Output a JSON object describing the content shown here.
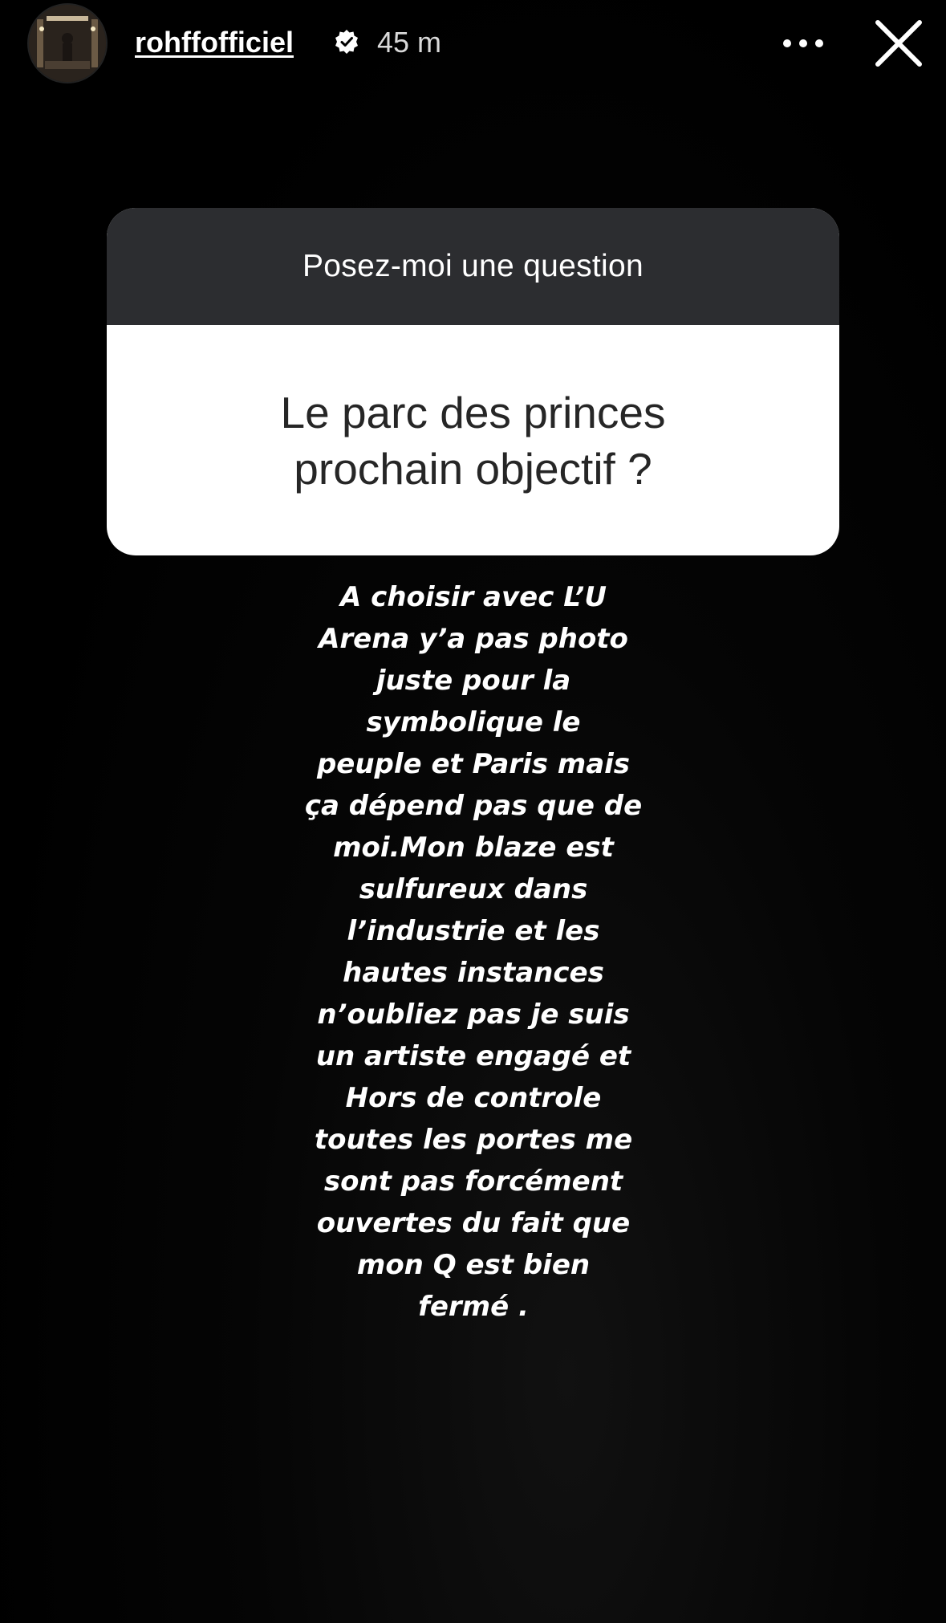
{
  "header": {
    "username": "rohffofficiel",
    "timestamp": "45 m",
    "avatar_icon": "profile-photo",
    "verified_icon": "verified-badge-icon",
    "more_icon": "more-options-icon",
    "close_icon": "close-icon"
  },
  "question_sticker": {
    "prompt": "Posez-moi une question",
    "question": "Le parc des princes prochain objectif ?"
  },
  "answer": {
    "text": "A choisir avec L’U\nArena y’a pas photo\njuste pour la\nsymbolique le\npeuple et Paris mais\nça dépend pas que de\nmoi.Mon blaze est\nsulfureux dans\nl’industrie et les\nhautes instances\nn’oubliez pas je suis\nun artiste engagé et\nHors de controle\ntoutes les portes me\nsont pas forcément\nouvertes du fait que\nmon Q est bien\nfermé ."
  },
  "colors": {
    "background": "#000000",
    "sticker_header": "#2c2d30",
    "sticker_body": "#ffffff",
    "question_text": "#262626",
    "text": "#ffffff"
  }
}
